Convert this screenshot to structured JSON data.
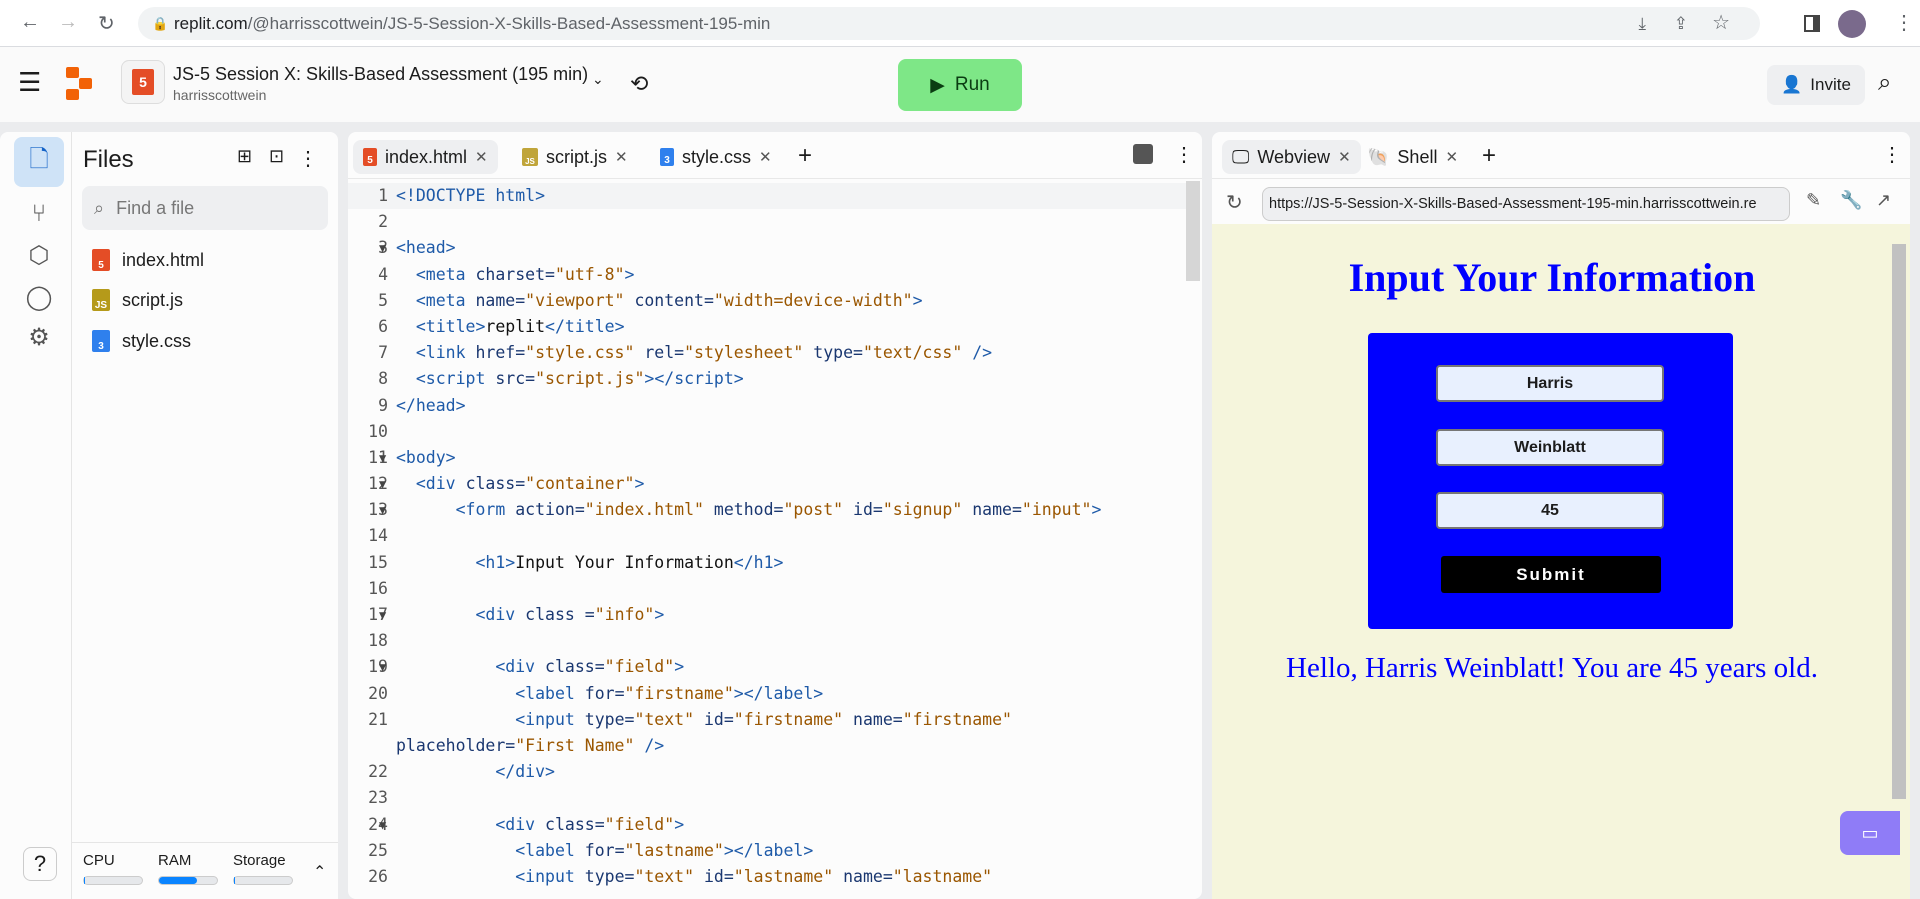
{
  "browser": {
    "url_host": "replit.com",
    "url_path": "/@harrisscottwein/JS-5-Session-X-Skills-Based-Assessment-195-min"
  },
  "header": {
    "repl_title": "JS-5 Session X: Skills-Based Assessment (195 min)",
    "owner": "harrisscottwein",
    "run_label": "Run",
    "invite_label": "Invite"
  },
  "files": {
    "title": "Files",
    "search_placeholder": "Find a file",
    "items": [
      {
        "name": "index.html",
        "type": "html"
      },
      {
        "name": "script.js",
        "type": "js"
      },
      {
        "name": "style.css",
        "type": "css"
      }
    ]
  },
  "resources": {
    "cpu_label": "CPU",
    "ram_label": "RAM",
    "storage_label": "Storage",
    "cpu": 0.01,
    "ram": 0.65,
    "storage": 0.0
  },
  "editor": {
    "tabs": [
      {
        "label": "index.html"
      },
      {
        "label": "script.js"
      },
      {
        "label": "style.css"
      }
    ],
    "lines": [
      {
        "n": "1",
        "f": false,
        "html": "<span class='t'>&lt;!DOCTYPE html&gt;</span>"
      },
      {
        "n": "2",
        "f": false,
        "html": ""
      },
      {
        "n": "3",
        "f": true,
        "html": "<span class='t'>&lt;head&gt;</span>"
      },
      {
        "n": "4",
        "f": false,
        "html": "  <span class='t'>&lt;meta</span> <span class='a'>charset=</span><span class='s'>\"utf-8\"</span><span class='t'>&gt;</span>"
      },
      {
        "n": "5",
        "f": false,
        "html": "  <span class='t'>&lt;meta</span> <span class='a'>name=</span><span class='s'>\"viewport\"</span> <span class='a'>content=</span><span class='s'>\"width=device-width\"</span><span class='t'>&gt;</span>"
      },
      {
        "n": "6",
        "f": false,
        "html": "  <span class='t'>&lt;title&gt;</span><span class='p'>replit</span><span class='t'>&lt;/title&gt;</span>"
      },
      {
        "n": "7",
        "f": false,
        "html": "  <span class='t'>&lt;link</span> <span class='a'>href=</span><span class='s'>\"style.css\"</span> <span class='a'>rel=</span><span class='s'>\"stylesheet\"</span> <span class='a'>type=</span><span class='s'>\"text/css\"</span> <span class='t'>/&gt;</span>"
      },
      {
        "n": "8",
        "f": false,
        "html": "  <span class='t'>&lt;script</span> <span class='a'>src=</span><span class='s'>\"script.js\"</span><span class='t'>&gt;&lt;/script&gt;</span>"
      },
      {
        "n": "9",
        "f": false,
        "html": "<span class='t'>&lt;/head&gt;</span>"
      },
      {
        "n": "10",
        "f": false,
        "html": ""
      },
      {
        "n": "11",
        "f": true,
        "html": "<span class='t'>&lt;body&gt;</span>"
      },
      {
        "n": "12",
        "f": true,
        "html": "  <span class='t'>&lt;div</span> <span class='a'>class=</span><span class='s'>\"container\"</span><span class='t'>&gt;</span>"
      },
      {
        "n": "13",
        "f": true,
        "html": "      <span class='t'>&lt;form</span> <span class='a'>action=</span><span class='s'>\"index.html\"</span> <span class='a'>method=</span><span class='s'>\"post\"</span> <span class='a'>id=</span><span class='s'>\"signup\"</span> <span class='a'>name=</span><span class='s'>\"input\"</span><span class='t'>&gt;</span>"
      },
      {
        "n": "14",
        "f": false,
        "html": ""
      },
      {
        "n": "15",
        "f": false,
        "html": "        <span class='t'>&lt;h1&gt;</span><span class='p'>Input Your Information</span><span class='t'>&lt;/h1&gt;</span>"
      },
      {
        "n": "16",
        "f": false,
        "html": ""
      },
      {
        "n": "17",
        "f": true,
        "html": "        <span class='t'>&lt;div</span> <span class='a'>class =</span><span class='s'>\"info\"</span><span class='t'>&gt;</span>"
      },
      {
        "n": "18",
        "f": false,
        "html": ""
      },
      {
        "n": "19",
        "f": true,
        "html": "          <span class='t'>&lt;div</span> <span class='a'>class=</span><span class='s'>\"field\"</span><span class='t'>&gt;</span>"
      },
      {
        "n": "20",
        "f": false,
        "html": "            <span class='t'>&lt;label</span> <span class='a'>for=</span><span class='s'>\"firstname\"</span><span class='t'>&gt;&lt;/label&gt;</span>"
      },
      {
        "n": "21",
        "f": false,
        "html": "            <span class='t'>&lt;input</span> <span class='a'>type=</span><span class='s'>\"text\"</span> <span class='a'>id=</span><span class='s'>\"firstname\"</span> <span class='a'>name=</span><span class='s'>\"firstname\"</span>"
      },
      {
        "n": "",
        "f": false,
        "html": "<span class='a'>placeholder=</span><span class='s'>\"First Name\"</span> <span class='t'>/&gt;</span>"
      },
      {
        "n": "22",
        "f": false,
        "html": "          <span class='t'>&lt;/div&gt;</span>"
      },
      {
        "n": "23",
        "f": false,
        "html": ""
      },
      {
        "n": "24",
        "f": true,
        "html": "          <span class='t'>&lt;div</span> <span class='a'>class=</span><span class='s'>\"field\"</span><span class='t'>&gt;</span>"
      },
      {
        "n": "25",
        "f": false,
        "html": "            <span class='t'>&lt;label</span> <span class='a'>for=</span><span class='s'>\"lastname\"</span><span class='t'>&gt;&lt;/label&gt;</span>"
      },
      {
        "n": "26",
        "f": false,
        "html": "            <span class='t'>&lt;input</span> <span class='a'>type=</span><span class='s'>\"text\"</span> <span class='a'>id=</span><span class='s'>\"lastname\"</span> <span class='a'>name=</span><span class='s'>\"lastname\"</span>"
      }
    ]
  },
  "webview": {
    "tabs": [
      {
        "label": "Webview"
      },
      {
        "label": "Shell"
      }
    ],
    "url": "https://JS-5-Session-X-Skills-Based-Assessment-195-min.harrisscottwein.re",
    "page": {
      "heading": "Input Your Information",
      "firstname": "Harris",
      "lastname": "Weinblatt",
      "age": "45",
      "submit_label": "Submit",
      "greeting": "Hello, Harris Weinblatt! You are 45 years old."
    }
  },
  "colors": {
    "run": "#7ee787",
    "page_bg": "#f5f5dc",
    "form_bg": "#0000ff",
    "heading": "#0000ff"
  }
}
